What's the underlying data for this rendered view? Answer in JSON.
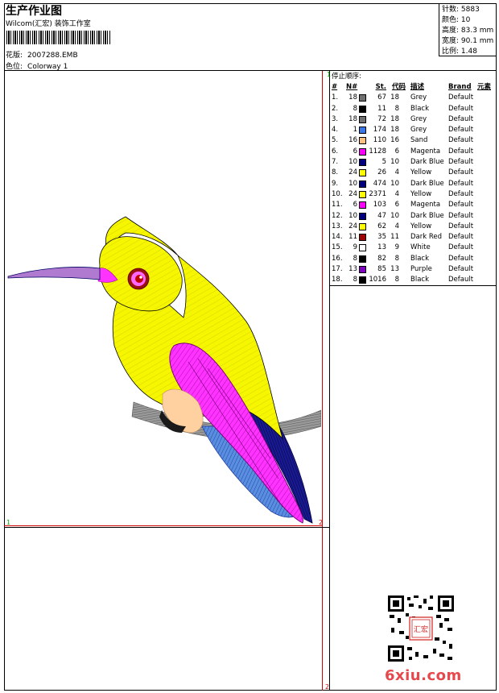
{
  "header": {
    "title": "生产作业图",
    "subtitle": "Wilcom(汇宏) 装饰工作室",
    "design_label": "花版:",
    "design_value": "2007288.EMB",
    "colorway_label": "色位:",
    "colorway_value": "Colorway 1"
  },
  "stats": {
    "stitches": "针数: 5883",
    "colors": "颜色: 10",
    "height": "高度: 83.3 mm",
    "width": "宽度: 90.1 mm",
    "scale": "比例: 1.48"
  },
  "stop_sequence": {
    "title": "停止顺序:",
    "headers": {
      "idx": "#",
      "n": "N#",
      "st": "St.",
      "code": "代码",
      "desc": "描述",
      "brand": "Brand",
      "elem": "元素"
    },
    "rows": [
      {
        "idx": "1.",
        "n": "18",
        "color": "#707070",
        "st": "67",
        "code": "18",
        "desc": "Grey",
        "brand": "Default"
      },
      {
        "idx": "2.",
        "n": "8",
        "color": "#000000",
        "st": "11",
        "code": "8",
        "desc": "Black",
        "brand": "Default"
      },
      {
        "idx": "3.",
        "n": "18",
        "color": "#707070",
        "st": "72",
        "code": "18",
        "desc": "Grey",
        "brand": "Default"
      },
      {
        "idx": "4.",
        "n": "1",
        "color": "#3a78e8",
        "st": "174",
        "code": "18",
        "desc": "Grey",
        "brand": "Default"
      },
      {
        "idx": "5.",
        "n": "16",
        "color": "#ffc080",
        "st": "110",
        "code": "16",
        "desc": "Sand",
        "brand": "Default"
      },
      {
        "idx": "6.",
        "n": "6",
        "color": "#ff00ff",
        "st": "1128",
        "code": "6",
        "desc": "Magenta",
        "brand": "Default"
      },
      {
        "idx": "7.",
        "n": "10",
        "color": "#000080",
        "st": "5",
        "code": "10",
        "desc": "Dark Blue",
        "brand": "Default"
      },
      {
        "idx": "8.",
        "n": "24",
        "color": "#ffff00",
        "st": "26",
        "code": "4",
        "desc": "Yellow",
        "brand": "Default"
      },
      {
        "idx": "9.",
        "n": "10",
        "color": "#000080",
        "st": "474",
        "code": "10",
        "desc": "Dark Blue",
        "brand": "Default"
      },
      {
        "idx": "10.",
        "n": "24",
        "color": "#ffff00",
        "st": "2371",
        "code": "4",
        "desc": "Yellow",
        "brand": "Default"
      },
      {
        "idx": "11.",
        "n": "6",
        "color": "#ff00ff",
        "st": "103",
        "code": "6",
        "desc": "Magenta",
        "brand": "Default"
      },
      {
        "idx": "12.",
        "n": "10",
        "color": "#000080",
        "st": "47",
        "code": "10",
        "desc": "Dark Blue",
        "brand": "Default"
      },
      {
        "idx": "13.",
        "n": "24",
        "color": "#ffff00",
        "st": "62",
        "code": "4",
        "desc": "Yellow",
        "brand": "Default"
      },
      {
        "idx": "14.",
        "n": "11",
        "color": "#a00000",
        "st": "35",
        "code": "11",
        "desc": "Dark Red",
        "brand": "Default"
      },
      {
        "idx": "15.",
        "n": "9",
        "color": "#ffffff",
        "st": "13",
        "code": "9",
        "desc": "White",
        "brand": "Default"
      },
      {
        "idx": "16.",
        "n": "8",
        "color": "#000000",
        "st": "82",
        "code": "8",
        "desc": "Black",
        "brand": "Default"
      },
      {
        "idx": "17.",
        "n": "13",
        "color": "#8000c0",
        "st": "85",
        "code": "13",
        "desc": "Purple",
        "brand": "Default"
      },
      {
        "idx": "18.",
        "n": "8",
        "color": "#000000",
        "st": "1016",
        "code": "8",
        "desc": "Black",
        "brand": "Default"
      }
    ]
  },
  "markers": {
    "green_1a": "1",
    "green_1b": "1",
    "red_2a": "2",
    "red_2b": "2"
  },
  "watermark": "6xiu.com",
  "stamp_text": "汇宏"
}
